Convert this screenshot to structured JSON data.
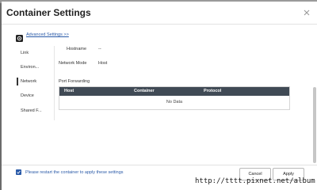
{
  "dialog": {
    "title": "Container Settings"
  },
  "advanced": {
    "label": "Advanced Settings >>"
  },
  "sidebar": {
    "items": [
      {
        "label": "Link",
        "active": false
      },
      {
        "label": "Environ...",
        "active": false
      },
      {
        "label": "Network",
        "active": true
      },
      {
        "label": "Device",
        "active": false
      },
      {
        "label": "Shared F...",
        "active": false
      }
    ]
  },
  "network": {
    "hostname_label": "Hostname",
    "hostname_value": "--",
    "mode_label": "Network Mode",
    "mode_value": "Host"
  },
  "port_forwarding": {
    "label": "Port Forwarding",
    "columns": [
      "Host",
      "Container",
      "Protocol"
    ],
    "empty_text": "No Data"
  },
  "footer": {
    "restart_text": "Please restart the container to apply these settings",
    "restart_checked": true,
    "cancel_label": "Cancel",
    "apply_label": "Apply"
  },
  "watermark": "http://tttt.pixnet.net/album",
  "colors": {
    "link": "#2a5aa8",
    "table_header": "#404a55",
    "backdrop": "#6b6b6b"
  },
  "icons": {
    "close": "close-icon",
    "settings": "gear-icon",
    "check": "check-icon"
  }
}
